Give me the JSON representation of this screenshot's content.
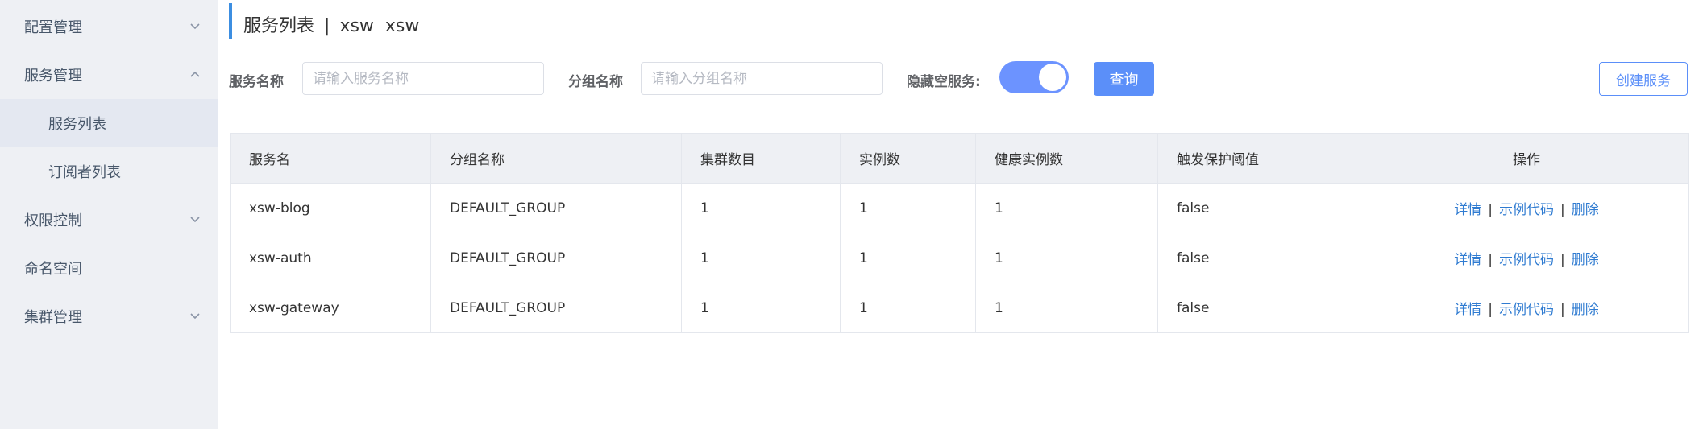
{
  "sidebar": {
    "items": [
      {
        "label": "配置管理"
      },
      {
        "label": "服务管理"
      },
      {
        "label": "服务列表"
      },
      {
        "label": "订阅者列表"
      },
      {
        "label": "权限控制"
      },
      {
        "label": "命名空间"
      },
      {
        "label": "集群管理"
      }
    ]
  },
  "header": {
    "title": "服务列表",
    "separator": "|",
    "namespace": "xsw  xsw"
  },
  "filters": {
    "service_name_label": "服务名称",
    "service_name_placeholder": "请输入服务名称",
    "group_name_label": "分组名称",
    "group_name_placeholder": "请输入分组名称",
    "hide_empty_label": "隐藏空服务:",
    "hide_empty_on": true,
    "query_label": "查询",
    "create_label": "创建服务"
  },
  "table": {
    "columns": [
      "服务名",
      "分组名称",
      "集群数目",
      "实例数",
      "健康实例数",
      "触发保护阈值",
      "操作"
    ],
    "rows": [
      {
        "name": "xsw-blog",
        "group": "DEFAULT_GROUP",
        "clusters": "1",
        "instances": "1",
        "healthy": "1",
        "threshold": "false"
      },
      {
        "name": "xsw-auth",
        "group": "DEFAULT_GROUP",
        "clusters": "1",
        "instances": "1",
        "healthy": "1",
        "threshold": "false"
      },
      {
        "name": "xsw-gateway",
        "group": "DEFAULT_GROUP",
        "clusters": "1",
        "instances": "1",
        "healthy": "1",
        "threshold": "false"
      }
    ],
    "actions": {
      "detail": "详情",
      "sample_code": "示例代码",
      "delete": "删除",
      "sep": "|"
    }
  },
  "colors": {
    "accent": "#5b8ff9",
    "link": "#2f7bd1",
    "sidebar_bg": "#eef0f4"
  }
}
